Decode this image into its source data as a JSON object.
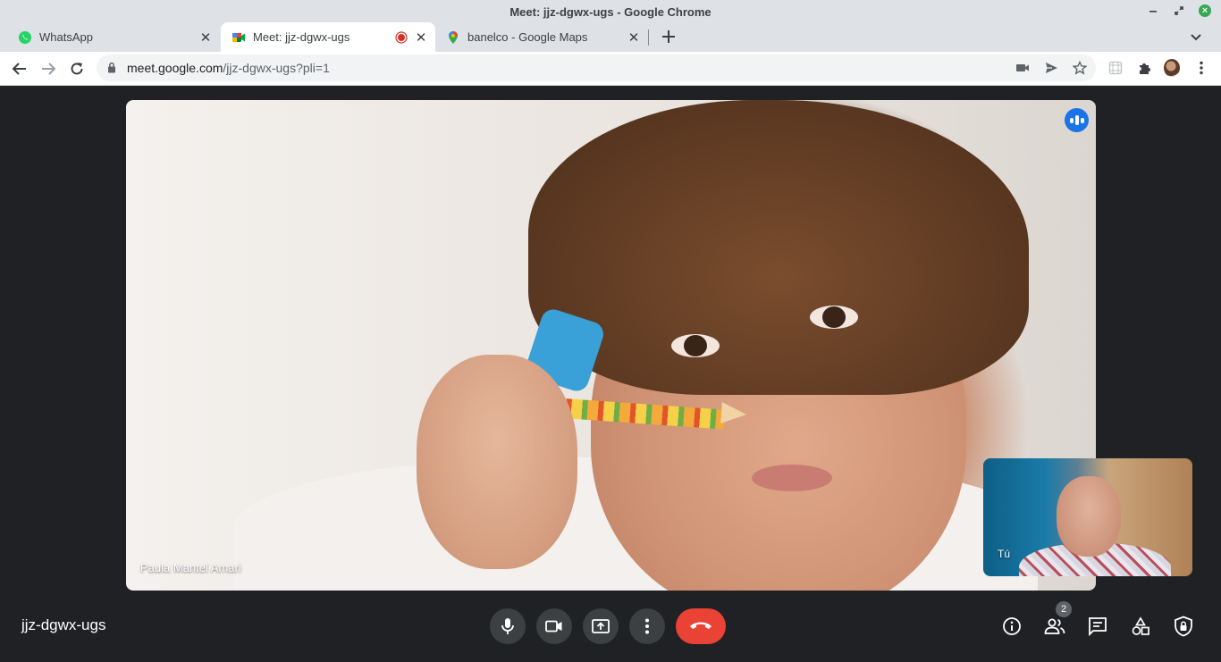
{
  "window": {
    "title": "Meet: jjz-dgwx-ugs - Google Chrome"
  },
  "tabs": [
    {
      "label": "WhatsApp",
      "icon": "whatsapp-icon"
    },
    {
      "label": "Meet: jjz-dgwx-ugs",
      "icon": "google-meet-icon",
      "recording": true,
      "active": true
    },
    {
      "label": "banelco - Google Maps",
      "icon": "google-maps-icon"
    }
  ],
  "address_bar": {
    "host": "meet.google.com",
    "path": "/jjz-dgwx-ugs?pli=1"
  },
  "meet": {
    "main_participant": "Paula Mantel Amari",
    "self_label": "Tú",
    "meeting_code": "jjz-dgwx-ugs",
    "participant_count": "2"
  },
  "colors": {
    "accent_blue": "#1a73e8",
    "hangup_red": "#ea4335",
    "meet_background": "#202124",
    "control_button": "#3c4043"
  }
}
